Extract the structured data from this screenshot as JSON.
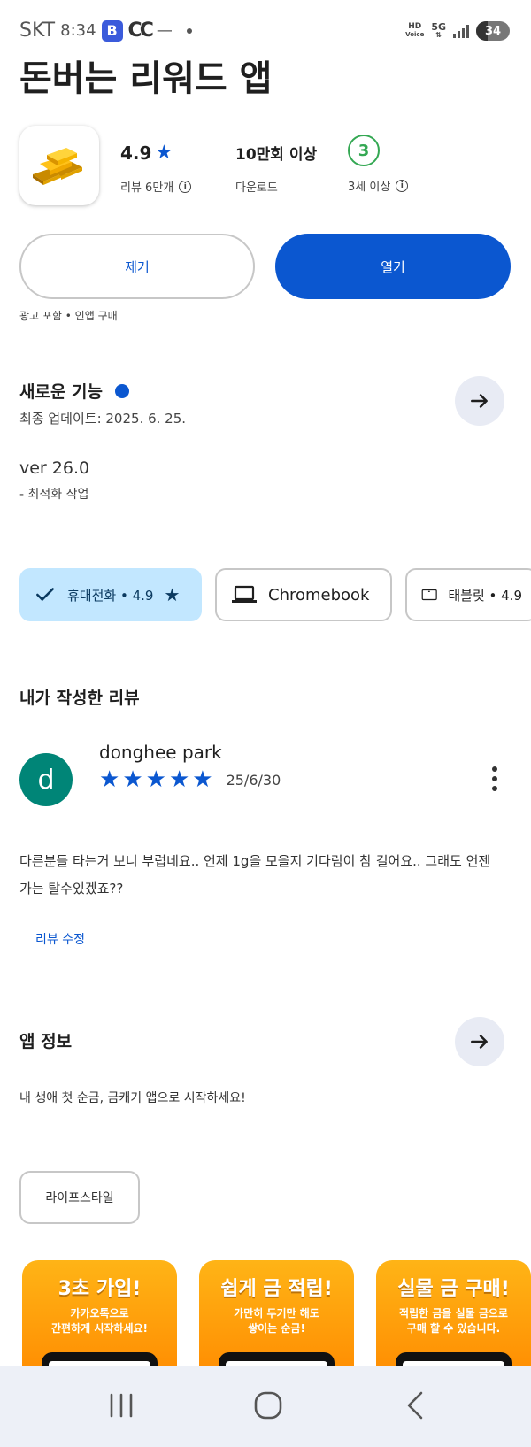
{
  "status_bar": {
    "carrier": "SKT",
    "time": "8:34",
    "app_icon_b": "B",
    "app_icon_c": "CC",
    "hd_voice": "HD",
    "voice_label": "Voice",
    "network": "5G",
    "battery": "34",
    "battery_level_percent": 34
  },
  "app": {
    "title": "돈버는 리워드 앱",
    "icon": "gold-bars-icon",
    "rating": "4.9",
    "reviews_label": "리뷰 6만개",
    "downloads": "10만회 이상",
    "downloads_label": "다운로드",
    "age_rating": "3",
    "age_label": "3세 이상"
  },
  "actions": {
    "remove_label": "제거",
    "open_label": "열기",
    "ad_note": "광고 포함 • 인앱 구매"
  },
  "whats_new": {
    "title": "새로운 기능",
    "updated": "최종 업데이트: 2025. 6. 25.",
    "version": "ver 26.0",
    "changes": "- 최적화 작업"
  },
  "device_chips": [
    {
      "label": "휴대전화 • 4.9",
      "icon": "check-icon",
      "selected": true
    },
    {
      "label": "Chromebook",
      "icon": "laptop-icon",
      "selected": false
    },
    {
      "label": "태블릿 • 4.9",
      "icon": "tablet-icon",
      "selected": false
    }
  ],
  "my_review": {
    "title": "내가 작성한 리뷰",
    "avatar_letter": "d",
    "reviewer": "donghee park",
    "stars": 5,
    "date": "25/6/30",
    "text": "다른분들 타는거 보니 부럽네요.. 언제 1g을 모을지 기다림이 참 길어요.. 그래도 언젠가는 탈수있겠죠??",
    "edit_label": "리뷰 수정"
  },
  "app_info": {
    "title": "앱 정보",
    "description": "내 생애 첫 순금, 금캐기 앱으로 시작하세요!",
    "tag": "라이프스타일"
  },
  "screenshots": [
    {
      "title": "3초 가입!",
      "line1": "카카오톡으로",
      "line2": "간편하게 시작하세요!"
    },
    {
      "title": "쉽게 금 적립!",
      "line1": "가만히 두기만 해도",
      "line2": "쌓이는 순금!"
    },
    {
      "title": "실물 금 구매!",
      "line1": "적립한 금을 실물 금으로",
      "line2": "구매 할 수 있습니다."
    }
  ],
  "colors": {
    "accent": "#0b57d0",
    "chip_selected": "#c2e7ff",
    "avatar": "#008577",
    "age_badge": "#34a853",
    "screenshot_orange": "#ff9800"
  }
}
